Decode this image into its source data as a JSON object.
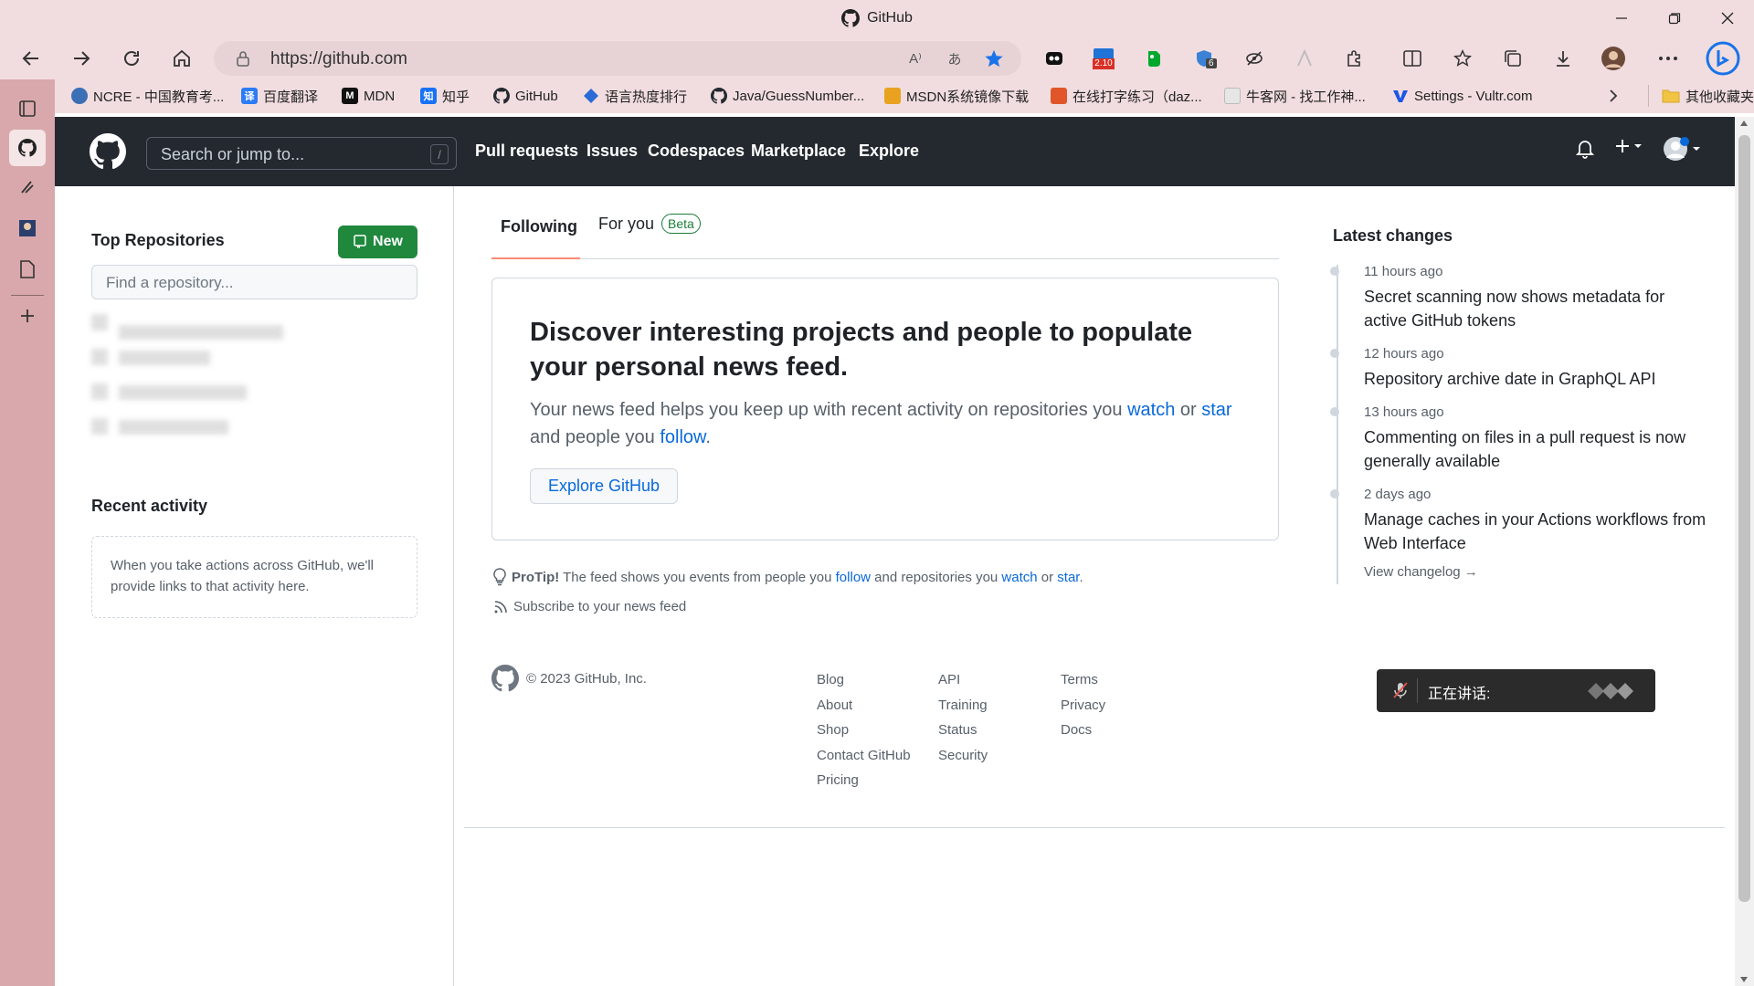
{
  "window": {
    "title": "GitHub"
  },
  "addressbar": {
    "url": "https://github.com",
    "read_aloud": "A⁾",
    "translate": "あ"
  },
  "extensions": {
    "badge_1": "2.10",
    "badge_2": "6"
  },
  "bookmarks": [
    {
      "label": "NCRE - 中国教育考...",
      "icon": "ncre-icon",
      "color": "#3b6fb6"
    },
    {
      "label": "百度翻译",
      "icon": "baidu-translate-icon",
      "color": "#2b7cf5",
      "glyph": "译"
    },
    {
      "label": "MDN",
      "icon": "mdn-icon",
      "color": "#111111",
      "glyph": "M"
    },
    {
      "label": "知乎",
      "icon": "zhihu-icon",
      "color": "#1772f6",
      "glyph": "知"
    },
    {
      "label": "GitHub",
      "icon": "github-icon",
      "color": "#24292f"
    },
    {
      "label": "语言热度排行",
      "icon": "diamond-icon",
      "color": "#2a6bd6"
    },
    {
      "label": "Java/GuessNumber...",
      "icon": "github-icon",
      "color": "#24292f"
    },
    {
      "label": "MSDN系统镜像下载",
      "icon": "msdn-icon",
      "color": "#e8a220"
    },
    {
      "label": "在线打字练习（daz...",
      "icon": "typing-icon",
      "color": "#e0562a"
    },
    {
      "label": "牛客网 - 找工作神...",
      "icon": "nowcoder-icon",
      "color": "#dddddd"
    },
    {
      "label": "Settings - Vultr.com",
      "icon": "vultr-icon",
      "color": "#1e56e6"
    }
  ],
  "bookmarks_other": "其他收藏夹",
  "header": {
    "search_placeholder": "Search or jump to...",
    "search_shortcut": "/",
    "nav": [
      "Pull requests",
      "Issues",
      "Codespaces",
      "Marketplace",
      "Explore"
    ],
    "plus_icon": "+"
  },
  "left": {
    "top_repos_title": "Top Repositories",
    "new_button": "New",
    "find_placeholder": "Find a repository...",
    "recent_activity_title": "Recent activity",
    "recent_activity_text": "When you take actions across GitHub, we'll provide links to that activity here."
  },
  "feed": {
    "tab_following": "Following",
    "tab_for_you": "For you",
    "beta_badge": "Beta",
    "discover_heading": "Discover interesting projects and people to populate your personal news feed.",
    "discover_p1": "Your news feed helps you keep up with recent activity on repositories you ",
    "discover_watch": "watch",
    "discover_or": " or ",
    "discover_star": "star",
    "discover_p2": " and people you ",
    "discover_follow": "follow",
    "discover_p3": ".",
    "explore_button": "Explore GitHub",
    "protip_label": "ProTip!",
    "protip_text": " The feed shows you events from people you ",
    "protip_follow": "follow",
    "protip_mid": " and repositories you ",
    "protip_watch": "watch",
    "protip_or": " or ",
    "protip_star": "star",
    "protip_end": ".",
    "subscribe": "Subscribe to your news feed"
  },
  "footer": {
    "copyright": "© 2023 GitHub, Inc.",
    "col1": [
      "Blog",
      "About",
      "Shop",
      "Contact GitHub",
      "Pricing"
    ],
    "col2": [
      "API",
      "Training",
      "Status",
      "Security"
    ],
    "col3": [
      "Terms",
      "Privacy",
      "Docs"
    ]
  },
  "latest": {
    "title": "Latest changes",
    "items": [
      {
        "when": "11 hours ago",
        "what": "Secret scanning now shows metadata for active GitHub tokens"
      },
      {
        "when": "12 hours ago",
        "what": "Repository archive date in GraphQL API"
      },
      {
        "when": "13 hours ago",
        "what": "Commenting on files in a pull request is now generally available"
      },
      {
        "when": "2 days ago",
        "what": "Manage caches in your Actions workflows from Web Interface"
      }
    ],
    "changelog": "View changelog →"
  },
  "speaking": {
    "label": "正在讲话:"
  },
  "colors": {
    "accent_green": "#1f883d",
    "link_blue": "#0969da",
    "header_dark": "#24292f",
    "tab_underline": "#fd8c73",
    "chrome_pink": "#f1dddf"
  }
}
